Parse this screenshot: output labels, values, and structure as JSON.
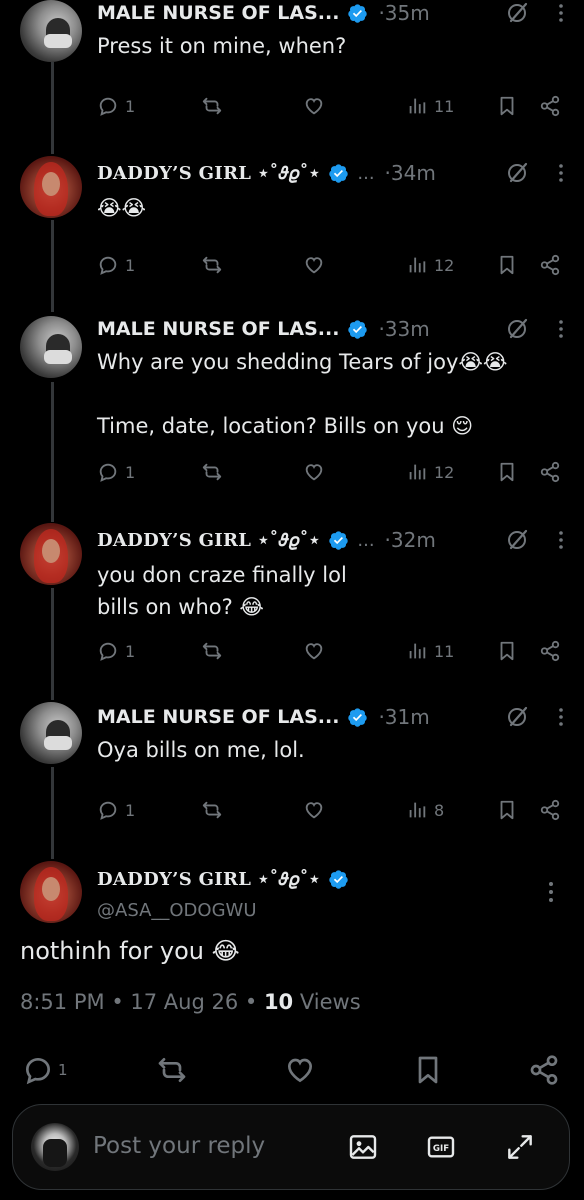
{
  "thread": [
    {
      "author": "MALE NURSE OF LAS...",
      "avatar": "nurse-avatar",
      "time": "·35m",
      "text": "Press it on mine, when?",
      "replies": "1",
      "views": "11"
    },
    {
      "author": "DADDY’S GIRL ⋆˚𝜗𝜚˚⋆",
      "avatar": "girl-avatar",
      "time": "·34m",
      "text": "😭😭",
      "replies": "1",
      "views": "12"
    },
    {
      "author": "MALE NURSE OF LAS...",
      "avatar": "nurse-avatar",
      "time": "·33m",
      "text": "Why are you shedding Tears of joy😭😭\n\nTime, date, location? Bills on you 😌",
      "replies": "1",
      "views": "12"
    },
    {
      "author": "DADDY’S GIRL ⋆˚𝜗𝜚˚⋆",
      "avatar": "girl-avatar",
      "time": "·32m",
      "text": "you don craze finally lol\nbills on who? 😂",
      "replies": "1",
      "views": "11"
    },
    {
      "author": "MALE NURSE OF LAS...",
      "avatar": "nurse-avatar",
      "time": "·31m",
      "text": "Oya bills on me, lol.",
      "replies": "1",
      "views": "8"
    }
  ],
  "ellipsis": "...",
  "main_post": {
    "author": "DADDY’S GIRL ⋆˚𝜗𝜚˚⋆",
    "handle": "@ASA__ODOGWU",
    "text": "nothinh for you 😂",
    "time": "8:51 PM",
    "date": "17 Aug 26",
    "views_count": "10",
    "views_label": "Views",
    "replies": "1"
  },
  "reply_bar": {
    "placeholder": "Post your reply"
  },
  "colors": {
    "background": "#000000",
    "text": "#e7e9ea",
    "muted": "#71767b",
    "verified": "#1d9bf0",
    "thread_line": "#333639"
  }
}
